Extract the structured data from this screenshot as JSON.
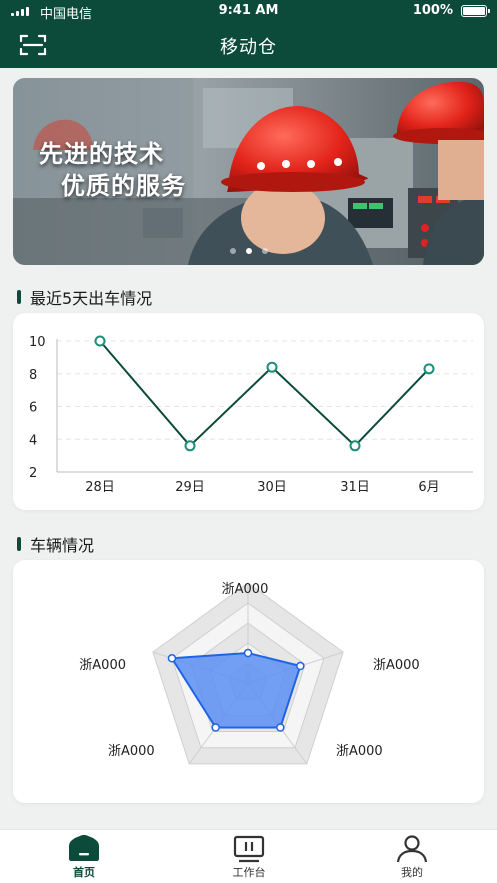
{
  "status_bar": {
    "carrier": "中国电信",
    "time": "9:41 AM",
    "battery": "100%"
  },
  "header": {
    "title": "移动仓",
    "scan_icon": "scan-icon"
  },
  "banner": {
    "line1": "先进的技术",
    "line2": "优质的服务",
    "dots": 3,
    "active_dot": 2
  },
  "trips_section": {
    "title": "最近5天出车情况"
  },
  "chart_data": {
    "type": "line",
    "categories": [
      "28日",
      "29日",
      "30日",
      "31日",
      "6月"
    ],
    "values": [
      10,
      3.6,
      8.4,
      3.6,
      8.3
    ],
    "yticks": [
      10,
      8,
      6,
      4,
      2
    ],
    "ylim": [
      2,
      10
    ],
    "grid": "horizontal dashed",
    "color": "#0c4b39",
    "marker_color": "#1a8f7a"
  },
  "vehicles_section": {
    "title": "车辆情况",
    "radar": {
      "type": "radar",
      "axes": [
        "浙A000",
        "浙A000",
        "浙A000",
        "浙A000",
        "浙A000"
      ],
      "values": [
        0.3,
        0.55,
        0.55,
        0.55,
        0.8
      ],
      "levels": 5,
      "fill_color": "#5b8ff2",
      "stroke_color": "#1f63e6"
    }
  },
  "tab_bar": {
    "items": [
      {
        "label": "首页",
        "icon": "home-icon",
        "active": true
      },
      {
        "label": "工作台",
        "icon": "workbench-icon",
        "active": false
      },
      {
        "label": "我的",
        "icon": "user-icon",
        "active": false
      }
    ]
  },
  "colors": {
    "primary": "#0c4b39",
    "background": "#eef1f0"
  }
}
